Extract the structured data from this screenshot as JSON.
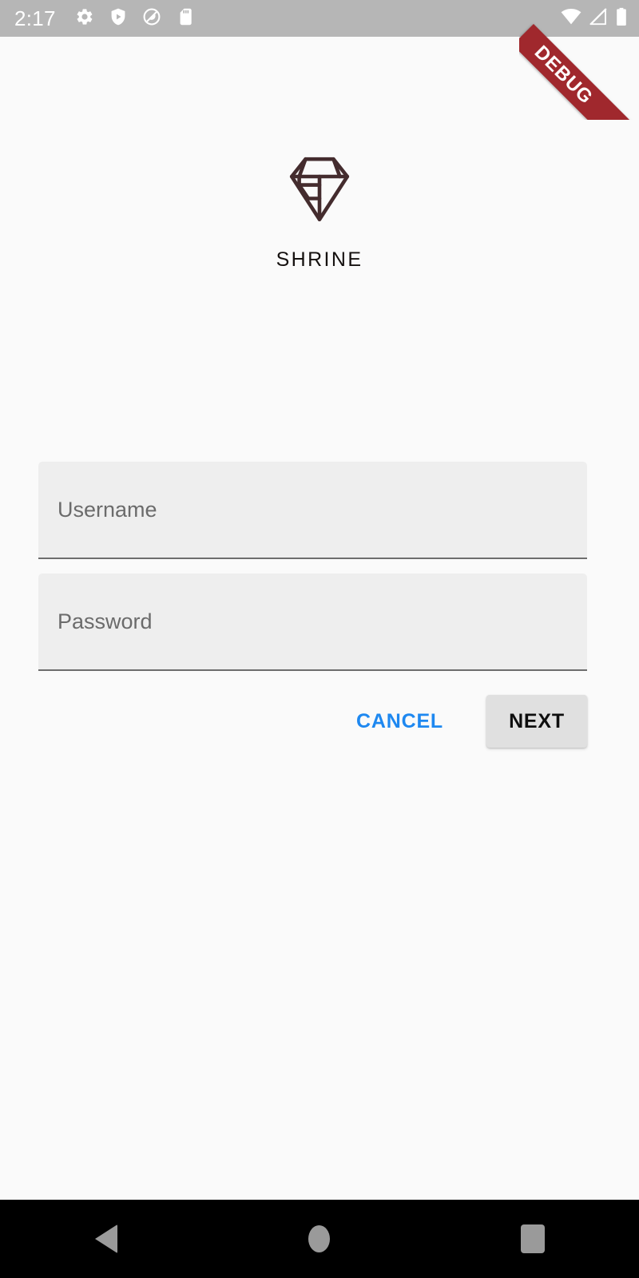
{
  "app": {
    "name": "SHRINE",
    "screen": "login"
  },
  "status_bar": {
    "clock": "2:17",
    "left_icons": [
      {
        "name": "settings-gear-icon",
        "glyph": "gear"
      },
      {
        "name": "play-protect-shield-icon",
        "glyph": "shield-play"
      },
      {
        "name": "screen-record-icon",
        "glyph": "circle-slash"
      },
      {
        "name": "sd-card-icon",
        "glyph": "sd-card"
      }
    ],
    "right_icons": [
      {
        "name": "wifi-icon",
        "glyph": "wifi"
      },
      {
        "name": "cell-signal-off-icon",
        "glyph": "signal-off"
      },
      {
        "name": "battery-icon",
        "glyph": "battery"
      }
    ],
    "background_color": "#b6b6b6",
    "icon_color": "#ffffff"
  },
  "debug_banner": {
    "label": "DEBUG",
    "color": "#a0282d",
    "text_color": "#ffffff"
  },
  "brand": {
    "logo_name": "shrine-diamond-logo",
    "logo_color": "#442c2e",
    "title": "SHRINE",
    "title_color": "#15110f"
  },
  "form": {
    "fields": [
      {
        "name": "username-field",
        "label": "Username",
        "value": "",
        "placeholder": "Username",
        "type": "text"
      },
      {
        "name": "password-field",
        "label": "Password",
        "value": "",
        "placeholder": "Password",
        "type": "password"
      }
    ],
    "fill_color": "#eeeeee",
    "underline_color": "#6d6d6d",
    "label_color": "#6b6b6b"
  },
  "actions": {
    "cancel_label": "CANCEL",
    "cancel_color": "#1e88f0",
    "next_label": "NEXT",
    "next_bg": "#e0e0e0",
    "next_color": "#0e0e0e"
  },
  "nav_bar": {
    "background_color": "#000000",
    "icon_color": "#9a9a9a",
    "buttons": [
      {
        "name": "nav-back-button",
        "label": "Back"
      },
      {
        "name": "nav-home-button",
        "label": "Home"
      },
      {
        "name": "nav-recents-button",
        "label": "Recents"
      }
    ]
  },
  "page": {
    "background_color": "#fafafa"
  }
}
